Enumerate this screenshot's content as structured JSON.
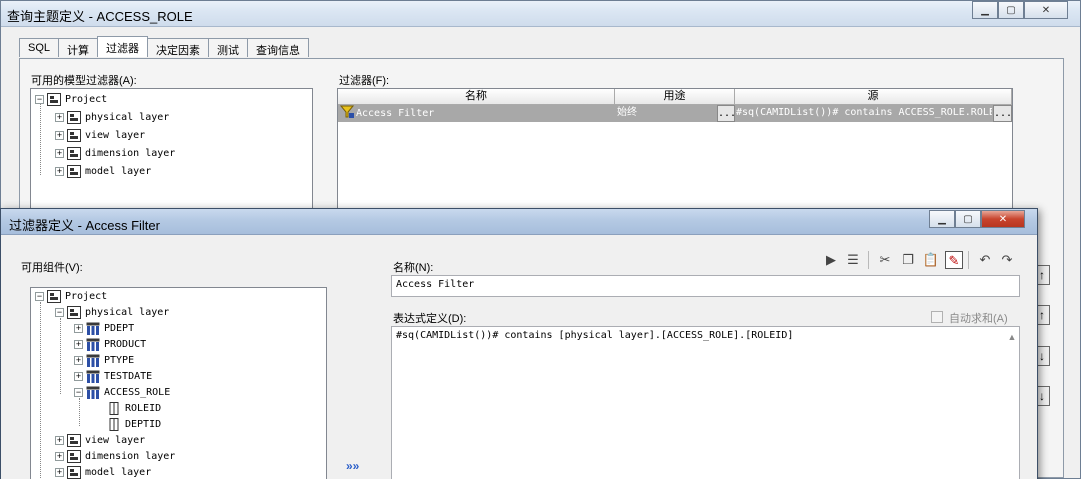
{
  "back_window": {
    "title": "查询主题定义 - ACCESS_ROLE",
    "tabs": [
      "SQL",
      "计算",
      "过滤器",
      "决定因素",
      "测试",
      "查询信息"
    ],
    "active_tab": "过滤器",
    "available_filters_label": "可用的模型过滤器(A):",
    "filters_label": "过滤器(F):",
    "tree": [
      {
        "label": "Project",
        "expanded": true
      },
      {
        "label": "physical layer"
      },
      {
        "label": "view layer"
      },
      {
        "label": "dimension layer"
      },
      {
        "label": "model layer"
      }
    ],
    "grid": {
      "headers": [
        "名称",
        "用途",
        "源"
      ],
      "rows": [
        {
          "name": "Access Filter",
          "usage": "始终",
          "usage_btn": "...",
          "source": "#sq(CAMIDList())# contains ACCESS_ROLE.ROLE",
          "source_btn": "..."
        }
      ]
    },
    "side_buttons": [
      "↑",
      "↑",
      "↓",
      "↓"
    ]
  },
  "front_window": {
    "title": "过滤器定义 - Access Filter",
    "available_components_label": "可用组件(V):",
    "name_label": "名称(N):",
    "name_value": "Access Filter",
    "expression_label": "表达式定义(D):",
    "auto_sum_label": "自动求和(A)",
    "expression_value": "#sq(CAMIDList())# contains [physical layer].[ACCESS_ROLE].[ROLEID]",
    "insert_arrow": "»»",
    "tree": [
      {
        "label": "Project",
        "level": 0,
        "expander": "-",
        "icon": "folder-icon"
      },
      {
        "label": "physical layer",
        "level": 1,
        "expander": "-",
        "icon": "folder-icon"
      },
      {
        "label": "PDEPT",
        "level": 2,
        "expander": "+",
        "icon": "query-subject-icon"
      },
      {
        "label": "PRODUCT",
        "level": 2,
        "expander": "+",
        "icon": "query-subject-icon"
      },
      {
        "label": "PTYPE",
        "level": 2,
        "expander": "+",
        "icon": "query-subject-icon"
      },
      {
        "label": "TESTDATE",
        "level": 2,
        "expander": "+",
        "icon": "query-subject-icon"
      },
      {
        "label": "ACCESS_ROLE",
        "level": 2,
        "expander": "-",
        "icon": "query-subject-icon"
      },
      {
        "label": "ROLEID",
        "level": 3,
        "expander": "",
        "icon": "column-icon"
      },
      {
        "label": "DEPTID",
        "level": 3,
        "expander": "",
        "icon": "column-icon"
      },
      {
        "label": "view layer",
        "level": 1,
        "expander": "+",
        "icon": "folder-icon"
      },
      {
        "label": "dimension layer",
        "level": 1,
        "expander": "+",
        "icon": "folder-icon"
      },
      {
        "label": "model layer",
        "level": 1,
        "expander": "+",
        "icon": "folder-icon"
      }
    ],
    "toolbar_icons": [
      "run-icon",
      "list-icon",
      "cut-icon",
      "copy-icon",
      "paste-icon",
      "edit-icon",
      "undo-icon",
      "redo-icon"
    ]
  }
}
